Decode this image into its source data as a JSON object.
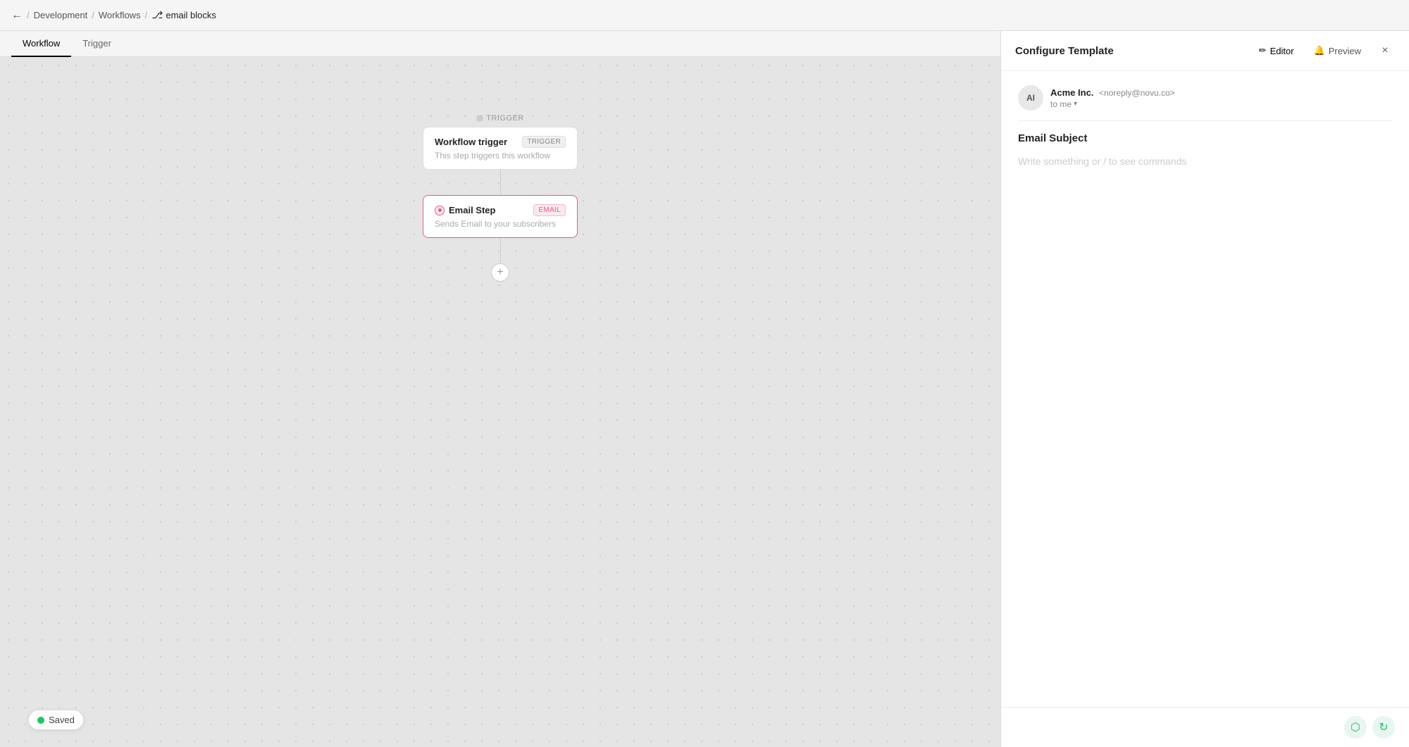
{
  "topNav": {
    "backLabel": "←",
    "breadcrumbs": [
      {
        "label": "Development",
        "href": "#"
      },
      {
        "label": "Workflows",
        "href": "#"
      },
      {
        "label": "email blocks",
        "icon": "⎇"
      }
    ]
  },
  "tabs": [
    {
      "id": "workflow",
      "label": "Workflow",
      "active": true
    },
    {
      "id": "trigger",
      "label": "Trigger",
      "active": false
    }
  ],
  "canvas": {
    "triggerSection": {
      "label": "TRIGGER",
      "icon": "◎",
      "card": {
        "title": "Workflow trigger",
        "badge": "TRIGGER",
        "description": "This step triggers this workflow"
      }
    },
    "emailStep": {
      "card": {
        "title": "Email Step",
        "badge": "EMAIL",
        "description": "Sends Email to your subscribers"
      }
    },
    "addStepLabel": "+"
  },
  "savedBadge": {
    "label": "Saved"
  },
  "rightPanel": {
    "title": "Configure Template",
    "actions": [
      {
        "id": "editor",
        "label": "Editor",
        "icon": "✏"
      },
      {
        "id": "preview",
        "label": "Preview",
        "icon": "🔔"
      }
    ],
    "closeIcon": "×",
    "email": {
      "senderName": "Acme Inc.",
      "senderEmail": "<noreply@novu.co>",
      "avatarInitials": "AI",
      "toLabel": "to me",
      "toChevron": "▾",
      "subjectLabel": "Email Subject",
      "bodyPlaceholder": "Write something or / to see commands"
    },
    "footer": {
      "icons": [
        "🌿",
        "↺"
      ]
    }
  }
}
